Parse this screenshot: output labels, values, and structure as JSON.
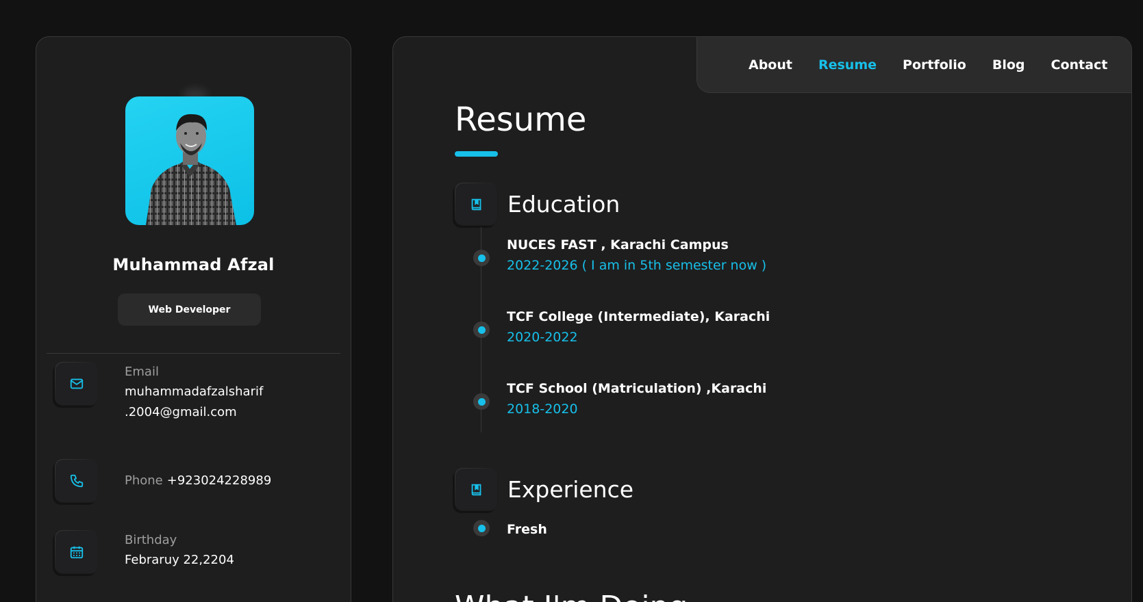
{
  "profile": {
    "name": "Muhammad Afzal",
    "role": "Web Developer"
  },
  "contacts": {
    "email": {
      "label": "Email",
      "value_line1": "muhammadafzalsharif",
      "value_line2": ".2004@gmail.com",
      "icon": "mail-icon"
    },
    "phone": {
      "label": "Phone",
      "value": "+923024228989",
      "icon": "phone-icon"
    },
    "birthday": {
      "label": "Birthday",
      "value": "Febraruy 22,2204",
      "icon": "calendar-icon"
    }
  },
  "nav": {
    "items": [
      {
        "label": "About",
        "active": false
      },
      {
        "label": "Resume",
        "active": true
      },
      {
        "label": "Portfolio",
        "active": false
      },
      {
        "label": "Blog",
        "active": false
      },
      {
        "label": "Contact",
        "active": false
      }
    ]
  },
  "resume": {
    "page_title": "Resume",
    "education": {
      "heading": "Education",
      "icon": "book-icon",
      "items": [
        {
          "title": "NUCES FAST , Karachi Campus",
          "date": "2022-2026 ( I am in 5th semester now )"
        },
        {
          "title": "TCF College (Intermediate), Karachi",
          "date": "2020-2022"
        },
        {
          "title": "TCF School (Matriculation) ,Karachi",
          "date": "2018-2020"
        }
      ]
    },
    "experience": {
      "heading": "Experience",
      "icon": "book-icon",
      "items": [
        {
          "title": "Fresh"
        }
      ]
    },
    "next_section_title": "What I'm Doing"
  },
  "colors": {
    "accent": "#17c0e9",
    "background": "#121212",
    "card": "#1e1e1f",
    "border": "#383838"
  }
}
